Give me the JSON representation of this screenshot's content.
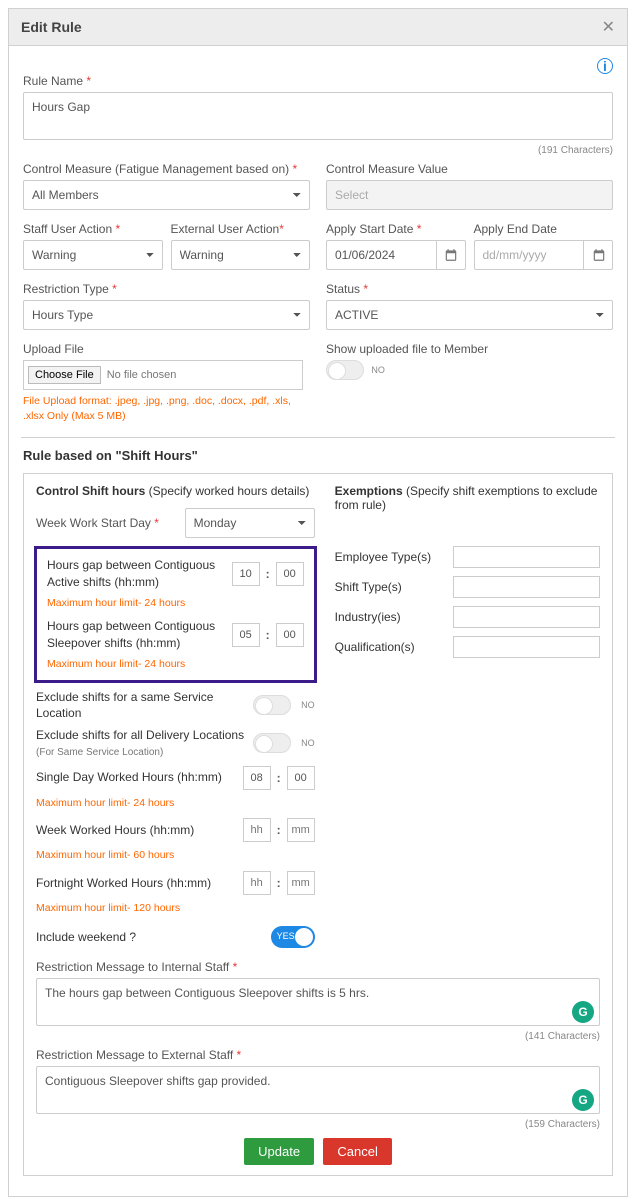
{
  "header": {
    "title": "Edit Rule"
  },
  "ruleName": {
    "label": "Rule Name",
    "value": "Hours Gap",
    "counter": "(191 Characters)"
  },
  "controlMeasure": {
    "label": "Control Measure (Fatigue Management based on)",
    "value": "All Members"
  },
  "controlMeasureValue": {
    "label": "Control Measure Value",
    "placeholder": "Select"
  },
  "staffAction": {
    "label": "Staff User Action",
    "value": "Warning"
  },
  "externalAction": {
    "label": "External User Action",
    "value": "Warning"
  },
  "applyStart": {
    "label": "Apply Start Date",
    "value": "01/06/2024"
  },
  "applyEnd": {
    "label": "Apply End Date",
    "placeholder": "dd/mm/yyyy"
  },
  "restrictionType": {
    "label": "Restriction Type",
    "value": "Hours Type"
  },
  "status": {
    "label": "Status",
    "value": "ACTIVE"
  },
  "upload": {
    "label": "Upload File",
    "button": "Choose File",
    "nofile": "No file chosen",
    "hint": "File Upload format: .jpeg, .jpg, .png, .doc, .docx, .pdf, .xls, .xlsx Only (Max 5 MB)"
  },
  "showUploaded": {
    "label": "Show uploaded file to Member",
    "state": "NO"
  },
  "sectionTitle": "Rule based on \"Shift Hours\"",
  "controlShift": {
    "header_bold": "Control Shift hours",
    "header_rest": " (Specify worked hours details)"
  },
  "weekStart": {
    "label": "Week Work Start Day",
    "value": "Monday"
  },
  "gapActive": {
    "label": "Hours gap between Contiguous Active shifts (hh:mm)",
    "hh": "10",
    "mm": "00",
    "note": "Maximum hour limit- 24 hours"
  },
  "gapSleep": {
    "label": "Hours gap between Contiguous Sleepover shifts (hh:mm)",
    "hh": "05",
    "mm": "00",
    "note": "Maximum hour limit- 24 hours"
  },
  "exclSameLoc": {
    "label": "Exclude shifts for a same Service Location",
    "state": "NO"
  },
  "exclAllLoc": {
    "label": "Exclude shifts for all Delivery Locations",
    "sub": "(For Same Service Location)",
    "state": "NO"
  },
  "singleDay": {
    "label": "Single Day Worked Hours (hh:mm)",
    "hh": "08",
    "mm": "00",
    "note": "Maximum hour limit- 24 hours"
  },
  "weekWorked": {
    "label": "Week Worked Hours (hh:mm)",
    "hh_ph": "hh",
    "mm_ph": "mm",
    "note": "Maximum hour limit- 60 hours"
  },
  "fortnight": {
    "label": "Fortnight Worked Hours (hh:mm)",
    "hh_ph": "hh",
    "mm_ph": "mm",
    "note": "Maximum hour limit- 120 hours"
  },
  "includeWeekend": {
    "label": "Include weekend ?",
    "state": "YES"
  },
  "msgInternal": {
    "label": "Restriction Message to Internal Staff",
    "value": "The hours gap between Contiguous Sleepover shifts is 5 hrs.",
    "counter": "(141 Characters)"
  },
  "msgExternal": {
    "label": "Restriction Message to External Staff",
    "value": "Contiguous Sleepover shifts gap provided.",
    "counter": "(159 Characters)"
  },
  "exemptions": {
    "header_bold": "Exemptions",
    "header_rest": " (Specify shift exemptions to exclude from rule)",
    "employeeType": "Employee Type(s)",
    "shiftType": "Shift Type(s)",
    "industries": "Industry(ies)",
    "qualifications": "Qualification(s)"
  },
  "buttons": {
    "update": "Update",
    "cancel": "Cancel"
  }
}
